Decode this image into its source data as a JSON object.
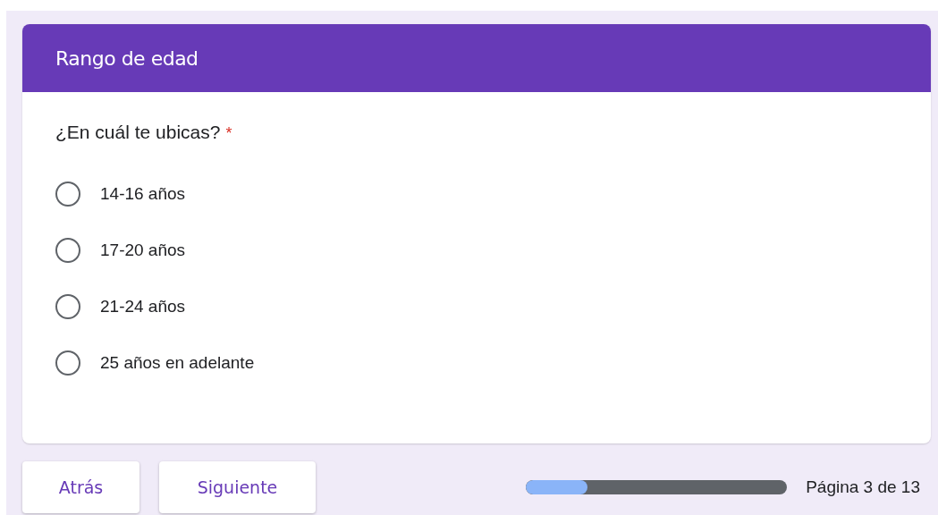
{
  "section": {
    "title": "Rango de edad"
  },
  "question": {
    "text": "¿En cuál te ubicas?",
    "required": true,
    "required_mark": "*"
  },
  "options": [
    {
      "label": "14-16 años",
      "selected": false
    },
    {
      "label": "17-20 años",
      "selected": false
    },
    {
      "label": "21-24 años",
      "selected": false
    },
    {
      "label": "25 años en adelante",
      "selected": false
    }
  ],
  "buttons": [
    "Atrás",
    "Siguiente"
  ],
  "progress": {
    "level": 0.235,
    "label": "Página 3 de 13"
  }
}
